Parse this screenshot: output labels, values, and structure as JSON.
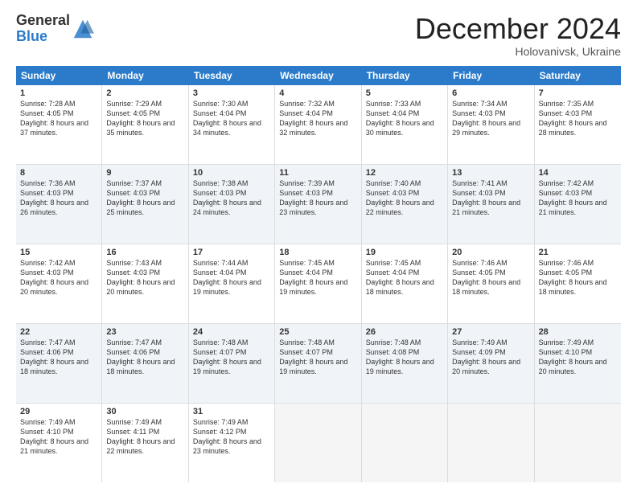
{
  "header": {
    "logo_line1": "General",
    "logo_line2": "Blue",
    "month": "December 2024",
    "location": "Holovanivsk, Ukraine"
  },
  "weekdays": [
    "Sunday",
    "Monday",
    "Tuesday",
    "Wednesday",
    "Thursday",
    "Friday",
    "Saturday"
  ],
  "weeks": [
    [
      {
        "day": "1",
        "sunrise": "7:28 AM",
        "sunset": "4:05 PM",
        "daylight": "8 hours and 37 minutes."
      },
      {
        "day": "2",
        "sunrise": "7:29 AM",
        "sunset": "4:05 PM",
        "daylight": "8 hours and 35 minutes."
      },
      {
        "day": "3",
        "sunrise": "7:30 AM",
        "sunset": "4:04 PM",
        "daylight": "8 hours and 34 minutes."
      },
      {
        "day": "4",
        "sunrise": "7:32 AM",
        "sunset": "4:04 PM",
        "daylight": "8 hours and 32 minutes."
      },
      {
        "day": "5",
        "sunrise": "7:33 AM",
        "sunset": "4:04 PM",
        "daylight": "8 hours and 30 minutes."
      },
      {
        "day": "6",
        "sunrise": "7:34 AM",
        "sunset": "4:03 PM",
        "daylight": "8 hours and 29 minutes."
      },
      {
        "day": "7",
        "sunrise": "7:35 AM",
        "sunset": "4:03 PM",
        "daylight": "8 hours and 28 minutes."
      }
    ],
    [
      {
        "day": "8",
        "sunrise": "7:36 AM",
        "sunset": "4:03 PM",
        "daylight": "8 hours and 26 minutes."
      },
      {
        "day": "9",
        "sunrise": "7:37 AM",
        "sunset": "4:03 PM",
        "daylight": "8 hours and 25 minutes."
      },
      {
        "day": "10",
        "sunrise": "7:38 AM",
        "sunset": "4:03 PM",
        "daylight": "8 hours and 24 minutes."
      },
      {
        "day": "11",
        "sunrise": "7:39 AM",
        "sunset": "4:03 PM",
        "daylight": "8 hours and 23 minutes."
      },
      {
        "day": "12",
        "sunrise": "7:40 AM",
        "sunset": "4:03 PM",
        "daylight": "8 hours and 22 minutes."
      },
      {
        "day": "13",
        "sunrise": "7:41 AM",
        "sunset": "4:03 PM",
        "daylight": "8 hours and 21 minutes."
      },
      {
        "day": "14",
        "sunrise": "7:42 AM",
        "sunset": "4:03 PM",
        "daylight": "8 hours and 21 minutes."
      }
    ],
    [
      {
        "day": "15",
        "sunrise": "7:42 AM",
        "sunset": "4:03 PM",
        "daylight": "8 hours and 20 minutes."
      },
      {
        "day": "16",
        "sunrise": "7:43 AM",
        "sunset": "4:03 PM",
        "daylight": "8 hours and 20 minutes."
      },
      {
        "day": "17",
        "sunrise": "7:44 AM",
        "sunset": "4:04 PM",
        "daylight": "8 hours and 19 minutes."
      },
      {
        "day": "18",
        "sunrise": "7:45 AM",
        "sunset": "4:04 PM",
        "daylight": "8 hours and 19 minutes."
      },
      {
        "day": "19",
        "sunrise": "7:45 AM",
        "sunset": "4:04 PM",
        "daylight": "8 hours and 18 minutes."
      },
      {
        "day": "20",
        "sunrise": "7:46 AM",
        "sunset": "4:05 PM",
        "daylight": "8 hours and 18 minutes."
      },
      {
        "day": "21",
        "sunrise": "7:46 AM",
        "sunset": "4:05 PM",
        "daylight": "8 hours and 18 minutes."
      }
    ],
    [
      {
        "day": "22",
        "sunrise": "7:47 AM",
        "sunset": "4:06 PM",
        "daylight": "8 hours and 18 minutes."
      },
      {
        "day": "23",
        "sunrise": "7:47 AM",
        "sunset": "4:06 PM",
        "daylight": "8 hours and 18 minutes."
      },
      {
        "day": "24",
        "sunrise": "7:48 AM",
        "sunset": "4:07 PM",
        "daylight": "8 hours and 19 minutes."
      },
      {
        "day": "25",
        "sunrise": "7:48 AM",
        "sunset": "4:07 PM",
        "daylight": "8 hours and 19 minutes."
      },
      {
        "day": "26",
        "sunrise": "7:48 AM",
        "sunset": "4:08 PM",
        "daylight": "8 hours and 19 minutes."
      },
      {
        "day": "27",
        "sunrise": "7:49 AM",
        "sunset": "4:09 PM",
        "daylight": "8 hours and 20 minutes."
      },
      {
        "day": "28",
        "sunrise": "7:49 AM",
        "sunset": "4:10 PM",
        "daylight": "8 hours and 20 minutes."
      }
    ],
    [
      {
        "day": "29",
        "sunrise": "7:49 AM",
        "sunset": "4:10 PM",
        "daylight": "8 hours and 21 minutes."
      },
      {
        "day": "30",
        "sunrise": "7:49 AM",
        "sunset": "4:11 PM",
        "daylight": "8 hours and 22 minutes."
      },
      {
        "day": "31",
        "sunrise": "7:49 AM",
        "sunset": "4:12 PM",
        "daylight": "8 hours and 23 minutes."
      },
      null,
      null,
      null,
      null
    ]
  ]
}
